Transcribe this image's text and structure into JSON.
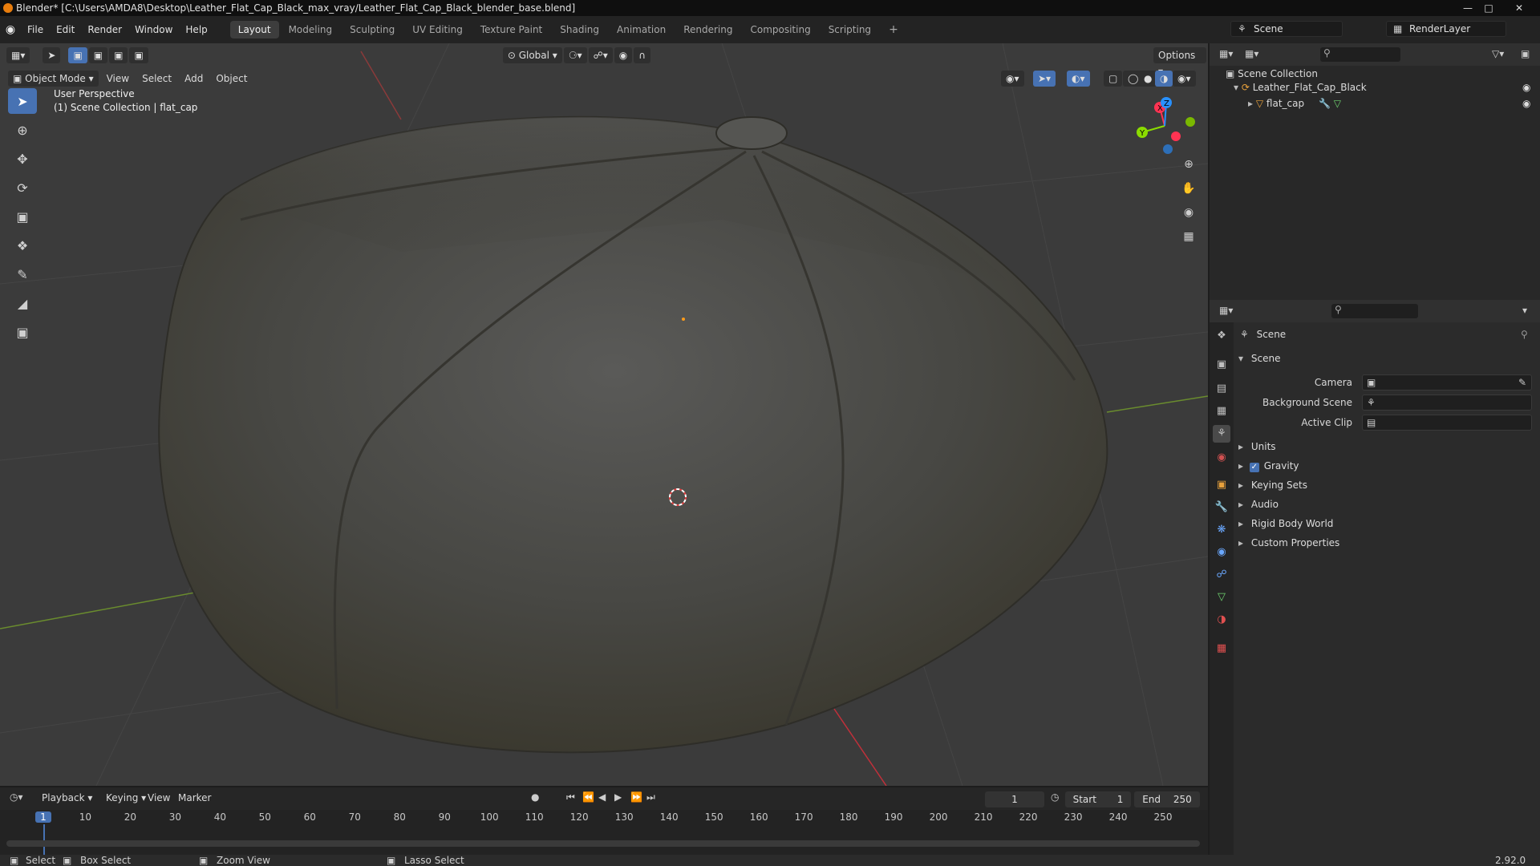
{
  "window": {
    "title": "Blender* [C:\\Users\\AMDA8\\Desktop\\Leather_Flat_Cap_Black_max_vray/Leather_Flat_Cap_Black_blender_base.blend]",
    "min_icon": "minimize-icon",
    "max_icon": "maximize-icon",
    "close_icon": "close-icon"
  },
  "menubar": {
    "items": [
      "File",
      "Edit",
      "Render",
      "Window",
      "Help"
    ],
    "workspaces": [
      "Layout",
      "Modeling",
      "Sculpting",
      "UV Editing",
      "Texture Paint",
      "Shading",
      "Animation",
      "Rendering",
      "Compositing",
      "Scripting"
    ],
    "active_workspace": "Layout",
    "add_tab": "+",
    "scene": "Scene",
    "view_layer": "RenderLayer"
  },
  "viewport": {
    "mode": "Object Mode",
    "menus": [
      "View",
      "Select",
      "Add",
      "Object"
    ],
    "transform_orientation": "Global",
    "options": "Options",
    "perspective_label": "User Perspective",
    "collection_label": "(1) Scene Collection | flat_cap",
    "gizmo_axes": [
      "X",
      "Y",
      "Z"
    ]
  },
  "outliner": {
    "root": "Scene Collection",
    "items": [
      {
        "name": "Leather_Flat_Cap_Black"
      },
      {
        "name": "flat_cap"
      }
    ]
  },
  "properties": {
    "context": "Scene",
    "section": "Scene",
    "fields": [
      {
        "label": "Camera"
      },
      {
        "label": "Background Scene"
      },
      {
        "label": "Active Clip"
      }
    ],
    "panels": [
      "Units",
      "Gravity",
      "Keying Sets",
      "Audio",
      "Rigid Body World",
      "Custom Properties"
    ],
    "gravity_checked": true
  },
  "timeline": {
    "menus": [
      "Playback",
      "Keying",
      "View",
      "Marker"
    ],
    "current_frame": "1",
    "start_label": "Start",
    "start": "1",
    "end_label": "End",
    "end": "250",
    "ticks": [
      "1",
      "10",
      "20",
      "30",
      "40",
      "50",
      "60",
      "70",
      "80",
      "90",
      "100",
      "110",
      "120",
      "130",
      "140",
      "150",
      "160",
      "170",
      "180",
      "190",
      "200",
      "210",
      "220",
      "230",
      "240",
      "250"
    ]
  },
  "statusbar": {
    "select": "Select",
    "box_select": "Box Select",
    "zoom_view": "Zoom View",
    "lasso_select": "Lasso Select",
    "version": "2.92.0"
  },
  "colors": {
    "accent": "#4772b3",
    "x_axis": "#ff3352",
    "y_axis": "#8bdc00",
    "z_axis": "#2890ff"
  }
}
